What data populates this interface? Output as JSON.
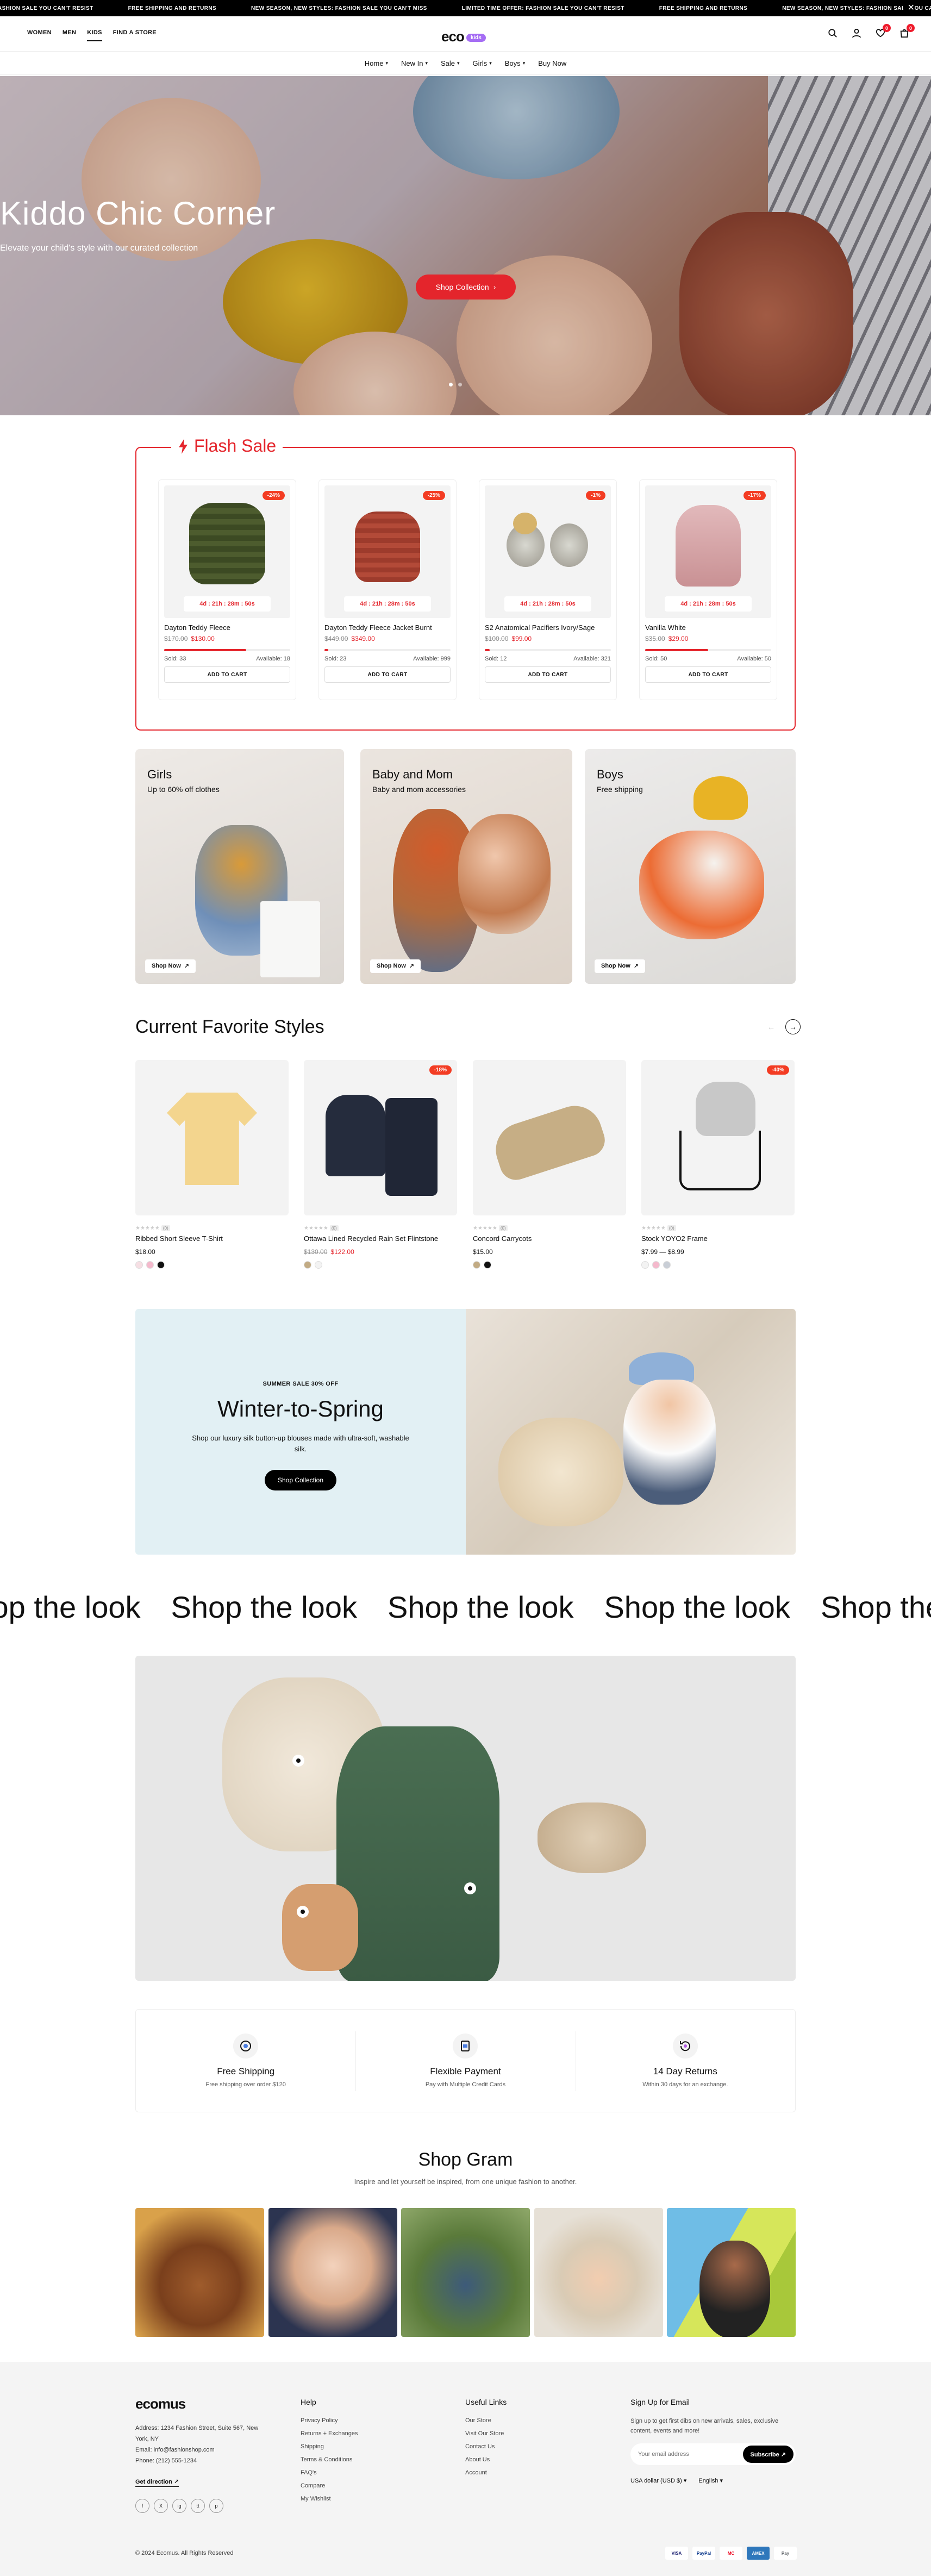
{
  "announcement": {
    "messages": [
      "FASHION SALE YOU CAN'T RESIST",
      "FREE SHIPPING AND RETURNS",
      "NEW SEASON, NEW STYLES: FASHION SALE YOU CAN'T MISS",
      "LIMITED TIME OFFER: FASHION SALE YOU CAN'T RESIST",
      "FREE SHIPPING AND RETURNS",
      "NEW SEASON, NEW STYLES: FASHION SALE YOU CAN'T MISS"
    ],
    "close": "✕"
  },
  "header": {
    "top_nav": [
      "WOMEN",
      "MEN",
      "KIDS",
      "FIND A STORE"
    ],
    "logo_word": "eco",
    "logo_tag": "kids",
    "wishlist_count": "0",
    "cart_count": "0"
  },
  "main_nav": [
    "Home",
    "New In",
    "Sale",
    "Girls",
    "Boys",
    "Buy Now"
  ],
  "hero": {
    "title": "Kiddo Chic Corner",
    "subtitle": "Elevate your child's style with our curated collection",
    "button": "Shop Collection"
  },
  "flash_sale": {
    "title": "Flash Sale",
    "atc": "ADD TO CART",
    "products": [
      {
        "name": "Dayton Teddy Fleece",
        "old": "$170.00",
        "new": "$130.00",
        "discount": "-24%",
        "timer": "4d : 21h : 28m : 50s",
        "sold": "Sold: 33",
        "available": "Available: 18",
        "sold_fraction": 0.65
      },
      {
        "name": "Dayton Teddy Fleece Jacket Burnt",
        "old": "$449.00",
        "new": "$349.00",
        "discount": "-25%",
        "timer": "4d : 21h : 28m : 50s",
        "sold": "Sold: 23",
        "available": "Available: 999",
        "sold_fraction": 0.03
      },
      {
        "name": "S2 Anatomical Pacifiers Ivory/Sage",
        "old": "$100.00",
        "new": "$99.00",
        "discount": "-1%",
        "timer": "4d : 21h : 28m : 50s",
        "sold": "Sold: 12",
        "available": "Available: 321",
        "sold_fraction": 0.04
      },
      {
        "name": "Vanilla White",
        "old": "$35.00",
        "new": "$29.00",
        "discount": "-17%",
        "timer": "4d : 21h : 28m : 50s",
        "sold": "Sold: 50",
        "available": "Available: 50",
        "sold_fraction": 0.5
      }
    ]
  },
  "categories": [
    {
      "title": "Girls",
      "sub": "Up to 60% off clothes",
      "link": "Shop Now"
    },
    {
      "title": "Baby and Mom",
      "sub": "Baby and mom accessories",
      "link": "Shop Now"
    },
    {
      "title": "Boys",
      "sub": "Free shipping",
      "link": "Shop Now"
    }
  ],
  "favorites": {
    "title": "Current Favorite Styles",
    "products": [
      {
        "name": "Ribbed Short Sleeve T-Shirt",
        "price": "$18.00",
        "old": "",
        "count": "(0)",
        "discount": "",
        "swatches": [
          "#f6dfe4",
          "#f4b9cc",
          "#111111"
        ]
      },
      {
        "name": "Ottawa Lined Recycled Rain Set Flintstone",
        "price": "$122.00",
        "old": "$130.00",
        "count": "(0)",
        "discount": "-18%",
        "swatches": [
          "#c2ab84",
          "#f3f3f3"
        ]
      },
      {
        "name": "Concord Carrycots",
        "price": "$15.00",
        "old": "",
        "count": "(0)",
        "discount": "",
        "swatches": [
          "#c2ab84",
          "#111111"
        ]
      },
      {
        "name": "Stock YOYO2 Frame",
        "price": "$7.99  —  $8.99",
        "old": "",
        "count": "(0)",
        "discount": "-40%",
        "swatches": [
          "#f3f3f3",
          "#f4b9cc",
          "#c9ced6"
        ]
      }
    ]
  },
  "winter": {
    "eyebrow": "SUMMER SALE 30% OFF",
    "title": "Winter-to-Spring",
    "desc": "Shop our luxury silk button-up blouses made with ultra-soft, washable silk.",
    "button": "Shop Collection"
  },
  "look": {
    "marquee": [
      "Shop the look",
      "Shop the look",
      "Shop the look",
      "Shop the look",
      "Shop the look"
    ]
  },
  "features": [
    {
      "title": "Free Shipping",
      "desc": "Free shipping over order $120"
    },
    {
      "title": "Flexible Payment",
      "desc": "Pay with Multiple Credit Cards"
    },
    {
      "title": "14 Day Returns",
      "desc": "Within 30 days for an exchange."
    }
  ],
  "gram": {
    "title": "Shop Gram",
    "sub": "Inspire and let yourself be inspired, from one unique fashion to another."
  },
  "footer": {
    "logo": "ecomus",
    "address": "Address: 1234 Fashion Street, Suite 567, New York, NY",
    "email": "Email: info@fashionshop.com",
    "phone": "Phone: (212) 555-1234",
    "direction": "Get direction",
    "social": [
      "f",
      "X",
      "ig",
      "tt",
      "p"
    ],
    "help_title": "Help",
    "help": [
      "Privacy Policy",
      "Returns + Exchanges",
      "Shipping",
      "Terms & Conditions",
      "FAQ's",
      "Compare",
      "My Wishlist"
    ],
    "links_title": "Useful Links",
    "links": [
      "Our Store",
      "Visit Our Store",
      "Contact Us",
      "About Us",
      "Account"
    ],
    "signup_title": "Sign Up for Email",
    "signup_text": "Sign up to get first dibs on new arrivals, sales, exclusive content, events and more!",
    "email_placeholder": "Your email address",
    "subscribe": "Subscribe",
    "currency": "USA dollar (USD $)",
    "language": "English",
    "copyright": "© 2024 Ecomus. All Rights Reserved",
    "payments": [
      "VISA",
      "PayPal",
      "MC",
      "AMEX",
      "Pay"
    ]
  }
}
